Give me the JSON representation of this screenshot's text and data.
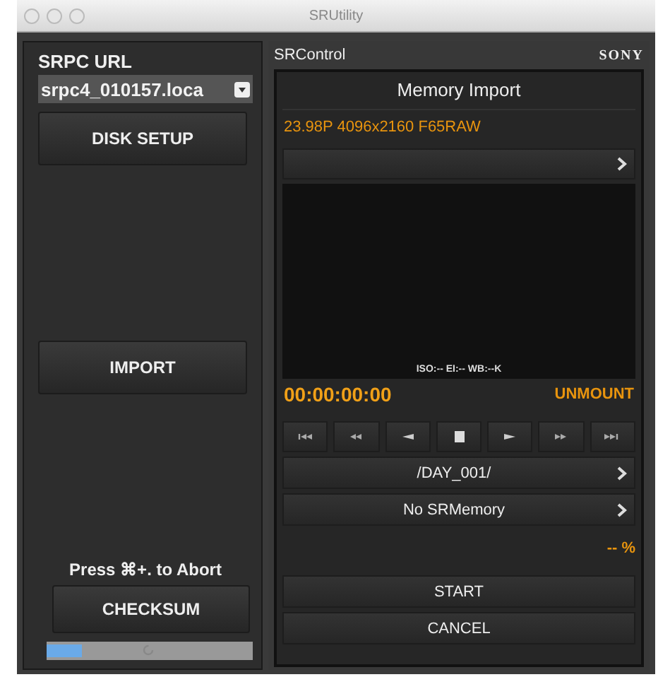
{
  "window": {
    "title": "SRUtility"
  },
  "left": {
    "url_label": "SRPC URL",
    "url_value": "srpc4_010157.loca",
    "buttons": [
      "DISK SETUP",
      "IMPORT"
    ],
    "abort_hint": "Press ⌘+. to Abort",
    "checksum": "CHECKSUM",
    "progress": {
      "level": 0.17
    }
  },
  "right": {
    "title": "SRControl",
    "brand": "SONY",
    "panel_title": "Memory Import",
    "format": "23.98P 4096x2160 F65RAW",
    "preview_info": "ISO:-- EI:-- WB:--K",
    "timecode": "00:00:00:00",
    "unmount": "UNMOUNT",
    "transport": [
      {
        "kind": "first"
      },
      {
        "kind": "rewind"
      },
      {
        "kind": "back"
      },
      {
        "kind": "stop"
      },
      {
        "kind": "play"
      },
      {
        "kind": "forward"
      },
      {
        "kind": "last"
      }
    ],
    "nav_rows": [
      "/DAY_001/",
      "No SRMemory"
    ],
    "percent": "-- %",
    "actions": [
      "START",
      "CANCEL"
    ]
  }
}
